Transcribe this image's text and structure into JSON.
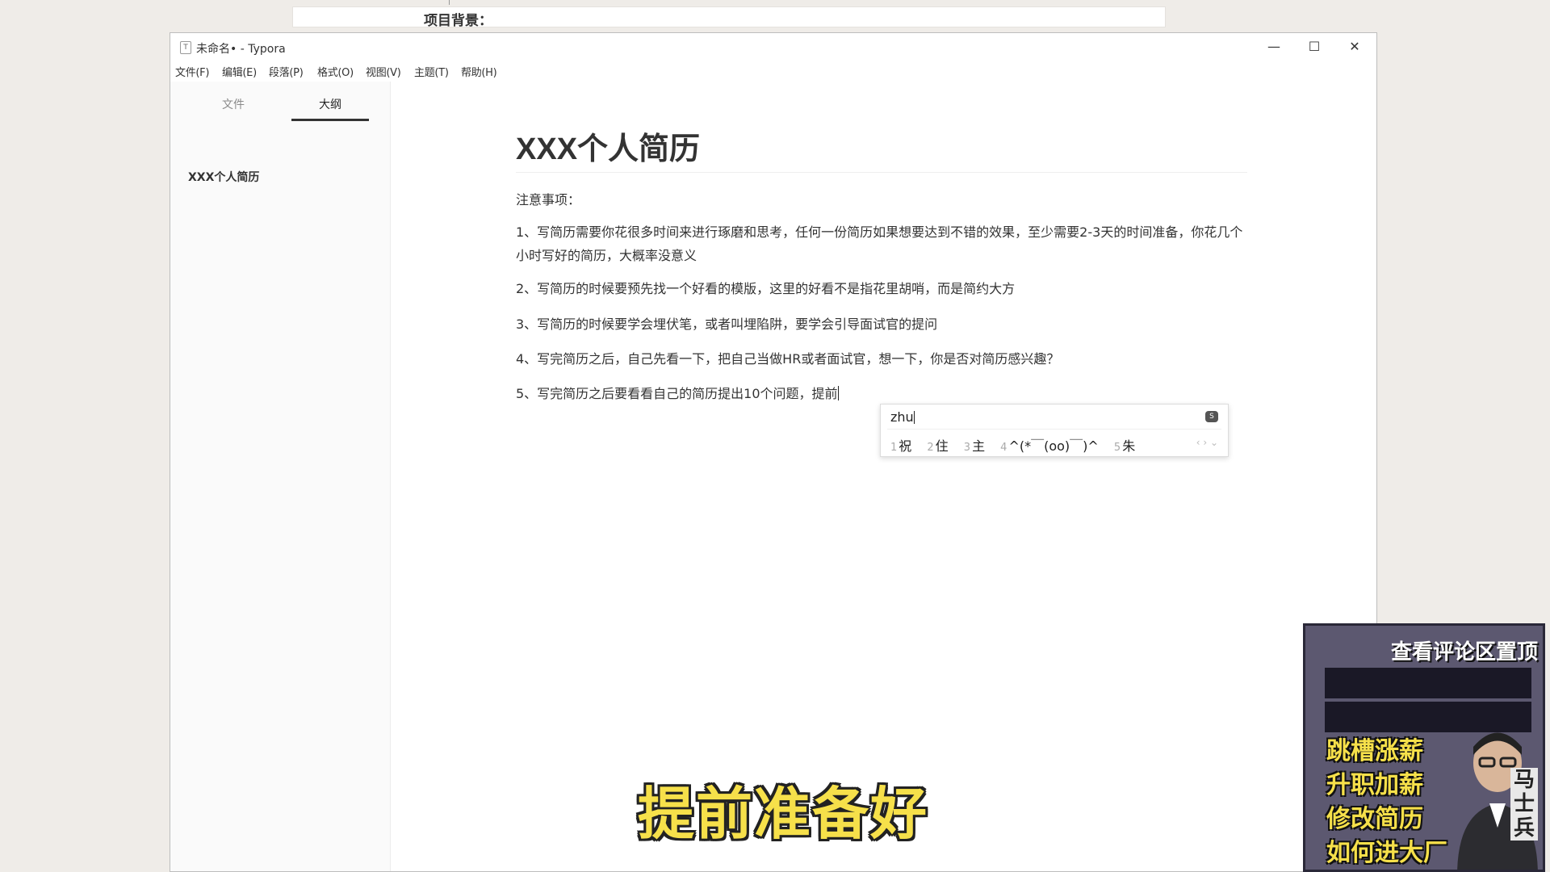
{
  "background": {
    "strip_text": "项目背景："
  },
  "window": {
    "title": "未命名• - Typora",
    "controls": {
      "minimize": "—",
      "maximize": "☐",
      "close": "✕"
    }
  },
  "menu": [
    "文件(F)",
    "编辑(E)",
    "段落(P)",
    "格式(O)",
    "视图(V)",
    "主题(T)",
    "帮助(H)"
  ],
  "sidebar": {
    "tabs": [
      "文件",
      "大纲"
    ],
    "active_tab": "大纲",
    "outline_items": [
      "XXX个人简历"
    ]
  },
  "document": {
    "title": "XXX个人简历",
    "note_heading": "注意事项：",
    "items": [
      "1、写简历需要你花很多时间来进行琢磨和思考，任何一份简历如果想要达到不错的效果，至少需要2-3天的时间准备，你花几个小时写好的简历，大概率没意义",
      "2、写简历的时候要预先找一个好看的模版，这里的好看不是指花里胡哨，而是简约大方",
      "3、写简历的时候要学会埋伏笔，或者叫埋陷阱，要学会引导面试官的提问",
      "4、写完简历之后，自己先看一下，把自己当做HR或者面试官，想一下，你是否对简历感兴趣？",
      "5、写完简历之后要看看自己的简历提出10个问题，提前"
    ]
  },
  "ime": {
    "input": "zhu",
    "candidates": [
      {
        "num": "1",
        "text": "祝"
      },
      {
        "num": "2",
        "text": "住"
      },
      {
        "num": "3",
        "text": "主"
      },
      {
        "num": "4",
        "text": "^(*￣(oo)￣)^"
      },
      {
        "num": "5",
        "text": "朱"
      }
    ],
    "nav": "‹ › ⌄"
  },
  "subtitle": "提前准备好",
  "promo": {
    "top": "查看评论区置顶",
    "lines": [
      "跳槽涨薪",
      "升职加薪",
      "修改简历",
      "如何进大厂"
    ],
    "name": "马士兵"
  }
}
